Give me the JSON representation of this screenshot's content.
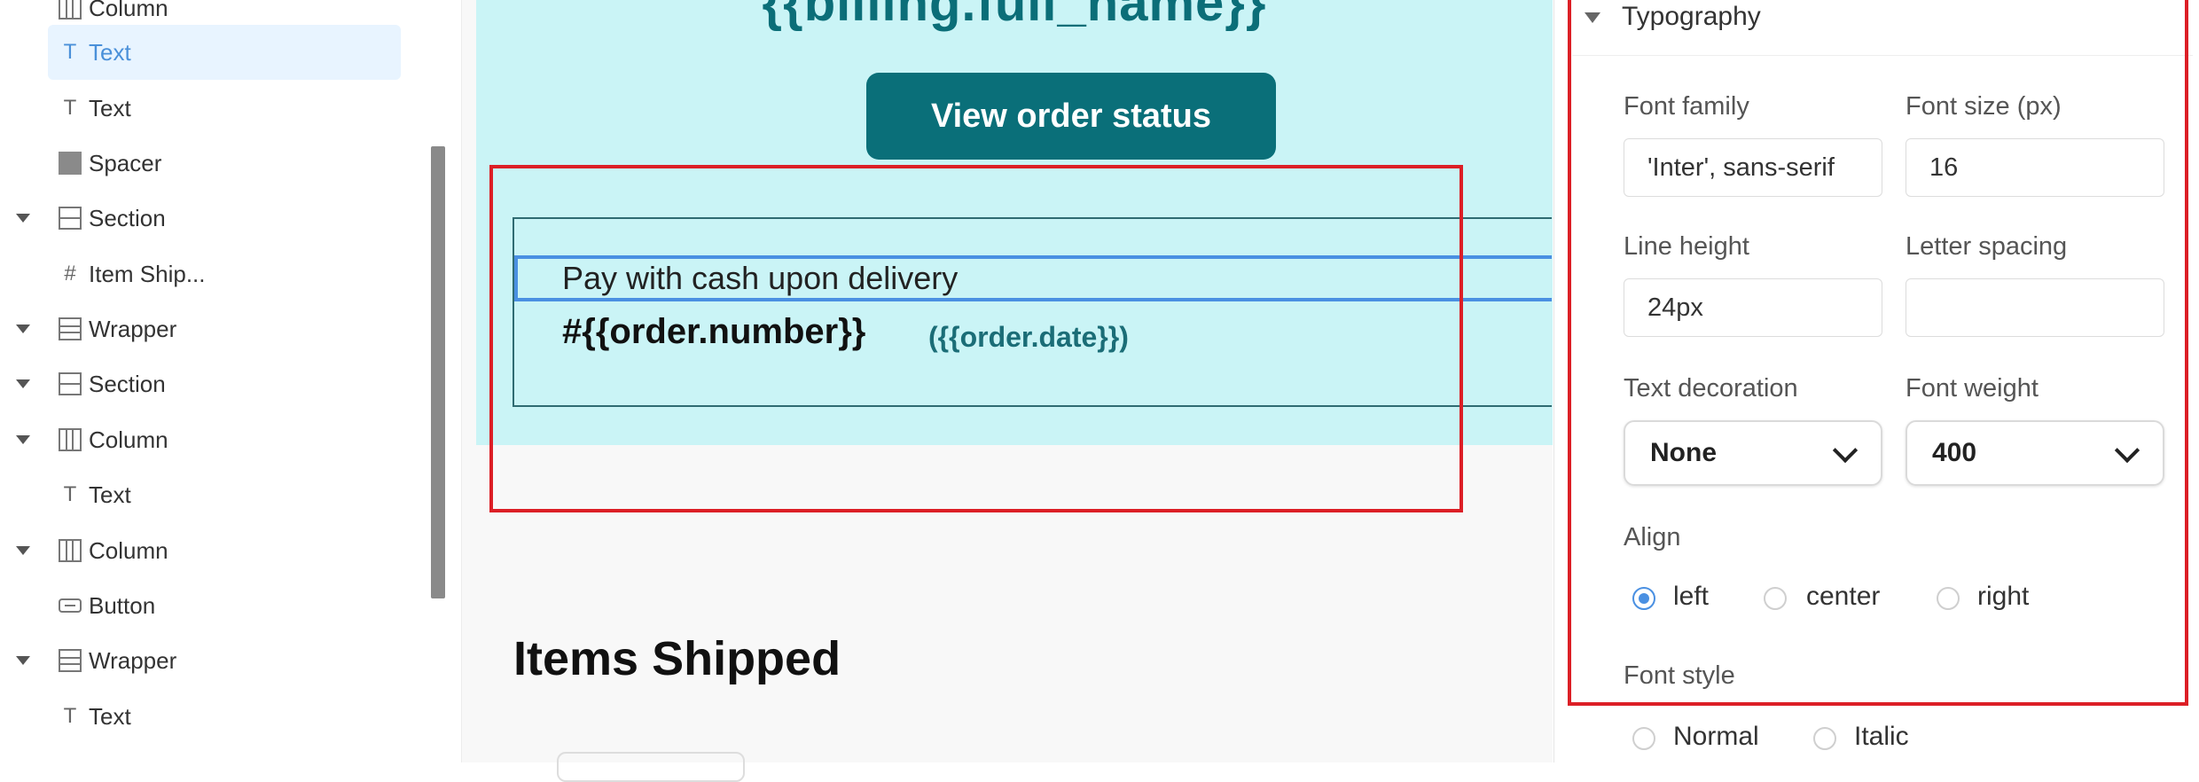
{
  "tree": {
    "items": [
      {
        "label": "Column",
        "icon": "column-icon",
        "caret": false
      },
      {
        "label": "Text",
        "icon": "text-icon",
        "caret": false,
        "selected": true
      },
      {
        "label": "Text",
        "icon": "text-icon",
        "caret": false
      },
      {
        "label": "Spacer",
        "icon": "spacer-icon",
        "caret": false
      },
      {
        "label": "Section",
        "icon": "section-icon",
        "caret": true
      },
      {
        "label": "Item Ship...",
        "icon": "hash-icon",
        "caret": false
      },
      {
        "label": "Wrapper",
        "icon": "wrapper-icon",
        "caret": true
      },
      {
        "label": "Section",
        "icon": "section-icon",
        "caret": true
      },
      {
        "label": "Column",
        "icon": "column-icon",
        "caret": true
      },
      {
        "label": "Text",
        "icon": "text-icon",
        "caret": false
      },
      {
        "label": "Column",
        "icon": "column-icon",
        "caret": true
      },
      {
        "label": "Button",
        "icon": "button-icon",
        "caret": false
      },
      {
        "label": "Wrapper",
        "icon": "wrapper-icon",
        "caret": true
      },
      {
        "label": "Text",
        "icon": "text-icon",
        "caret": false
      }
    ]
  },
  "canvas": {
    "hero_title": "{{billing.full_name}}",
    "view_button": "View order status",
    "cash_text": "Pay with cash upon delivery",
    "order_number": "#{{order.number}}",
    "order_date": "({{order.date}})",
    "items_title": "Items Shipped",
    "colors": {
      "hero_bg": "#caf4f6",
      "accent": "#0a6f79",
      "highlight": "#dc1f26"
    }
  },
  "panel": {
    "section_title": "Typography",
    "font_family_label": "Font family",
    "font_family_value": "'Inter', sans-serif",
    "font_size_label": "Font size (px)",
    "font_size_value": "16",
    "line_height_label": "Line height",
    "line_height_value": "24px",
    "letter_spacing_label": "Letter spacing",
    "letter_spacing_value": "",
    "text_decoration_label": "Text decoration",
    "text_decoration_value": "None",
    "font_weight_label": "Font weight",
    "font_weight_value": "400",
    "align_label": "Align",
    "align_options": [
      "left",
      "center",
      "right"
    ],
    "align_selected": "left",
    "font_style_label": "Font style",
    "font_style_options": [
      "Normal",
      "Italic"
    ]
  }
}
